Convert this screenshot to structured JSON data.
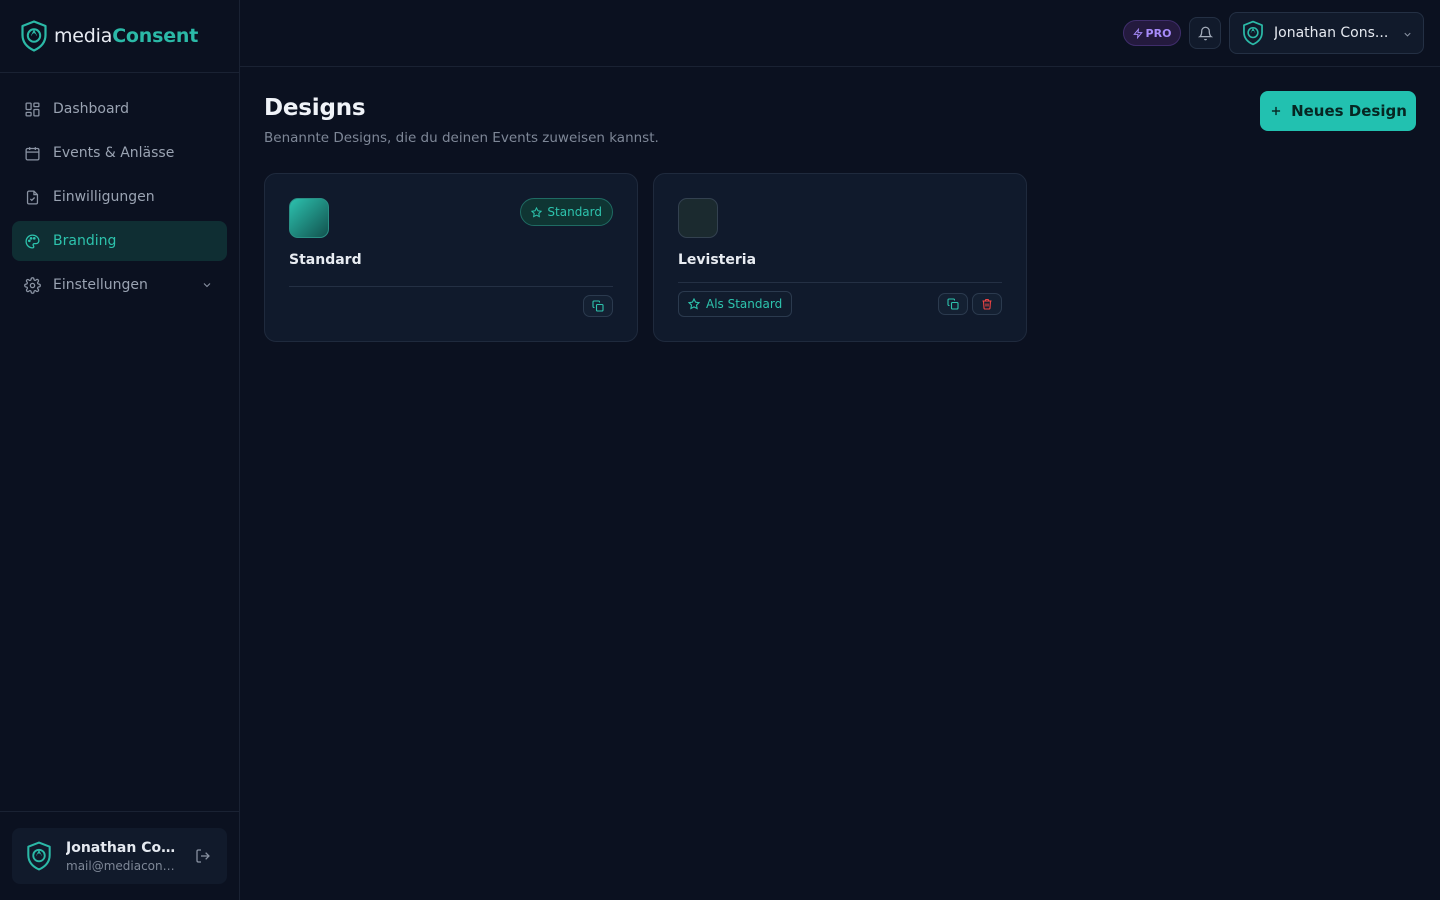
{
  "brand": {
    "name_part1": "media",
    "name_part2": "Consent",
    "accent": "#22c1b0"
  },
  "sidebar": {
    "items": [
      {
        "label": "Dashboard",
        "icon": "dashboard-icon"
      },
      {
        "label": "Events & Anlässe",
        "icon": "calendar-icon"
      },
      {
        "label": "Einwilligungen",
        "icon": "file-check-icon"
      },
      {
        "label": "Branding",
        "icon": "palette-icon",
        "active": true
      },
      {
        "label": "Einstellungen",
        "icon": "gear-icon",
        "expandable": true
      }
    ],
    "user": {
      "name": "Jonathan Cons...",
      "email": "mail@mediacons..."
    }
  },
  "topbar": {
    "pro_label": "PRO",
    "account_name": "Jonathan Cons..."
  },
  "main": {
    "title": "Designs",
    "subtitle": "Benannte Designs, die du deinen Events zuweisen kannst.",
    "new_button_label": "Neues Design",
    "designs": [
      {
        "name": "Standard",
        "is_default": true,
        "badge_label": "Standard"
      },
      {
        "name": "Levisteria",
        "is_default": false,
        "set_default_label": "Als Standard"
      }
    ]
  }
}
